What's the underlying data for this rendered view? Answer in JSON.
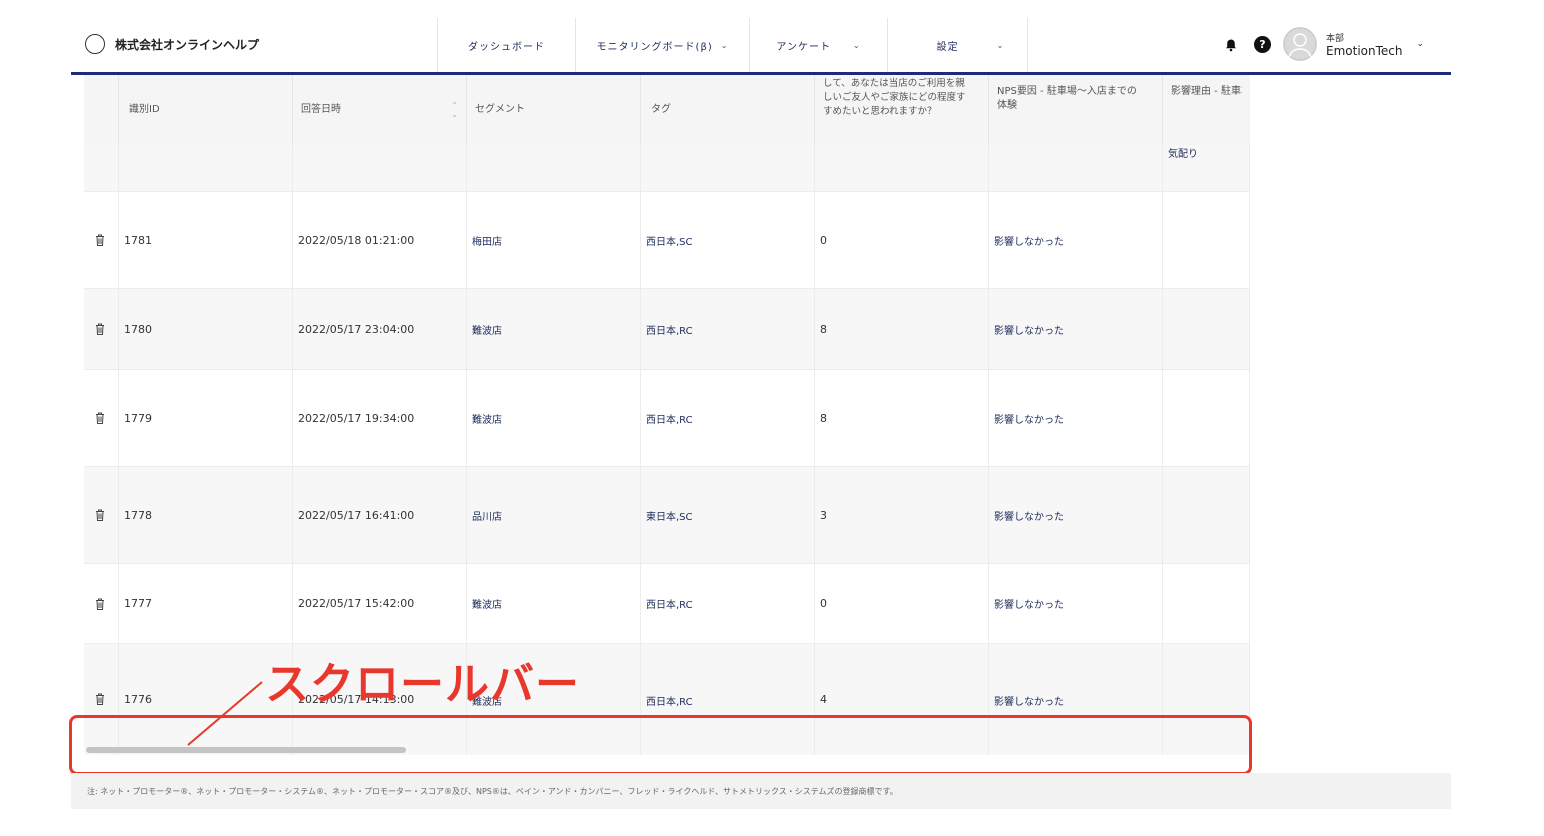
{
  "header": {
    "company": "株式会社オンラインヘルプ",
    "nav": [
      {
        "label": "ダッシュボード",
        "dropdown": false
      },
      {
        "label": "モニタリングボード(β)",
        "dropdown": true
      },
      {
        "label": "アンケート",
        "dropdown": true
      },
      {
        "label": "設定",
        "dropdown": true
      }
    ],
    "user_org": "本部",
    "user_name": "EmotionTech",
    "help_icon_glyph": "?"
  },
  "table": {
    "columns": [
      "識別ID",
      "回答日時",
      "セグメント",
      "タグ",
      "して、あなたは当店のご利用を親しいご友人やご家族にどの程度すすめたいと思われますか？",
      "NPS要因 - 駐車場〜入店までの体験",
      "影響理由 - 駐車場の体験"
    ],
    "partial_row": {
      "impact_reason": "気配り"
    },
    "rows": [
      {
        "id": "1781",
        "datetime": "2022/05/18 01:21:00",
        "segment": "梅田店",
        "tag": "西日本,SC",
        "score": "0",
        "nps_factor": "影響しなかった"
      },
      {
        "id": "1780",
        "datetime": "2022/05/17 23:04:00",
        "segment": "難波店",
        "tag": "西日本,RC",
        "score": "8",
        "nps_factor": "影響しなかった"
      },
      {
        "id": "1779",
        "datetime": "2022/05/17 19:34:00",
        "segment": "難波店",
        "tag": "西日本,RC",
        "score": "8",
        "nps_factor": "影響しなかった"
      },
      {
        "id": "1778",
        "datetime": "2022/05/17 16:41:00",
        "segment": "品川店",
        "tag": "東日本,SC",
        "score": "3",
        "nps_factor": "影響しなかった"
      },
      {
        "id": "1777",
        "datetime": "2022/05/17 15:42:00",
        "segment": "難波店",
        "tag": "西日本,RC",
        "score": "0",
        "nps_factor": "影響しなかった"
      },
      {
        "id": "1776",
        "datetime": "2022/05/17 14:13:00",
        "segment": "難波店",
        "tag": "西日本,RC",
        "score": "4",
        "nps_factor": "影響しなかった"
      }
    ]
  },
  "annotation": {
    "label": "スクロールバー",
    "color": "#e8372c"
  },
  "footer": "注: ネット・プロモーター®、ネット・プロモーター・システム®、ネット・プロモーター・スコア®及び、NPS®は、ベイン・アンド・カンパニー、フレッド・ライクヘルド、サトメトリックス・システムズの登録商標です。",
  "colors": {
    "accent": "#1f2a7a",
    "annotation": "#e8372c"
  }
}
